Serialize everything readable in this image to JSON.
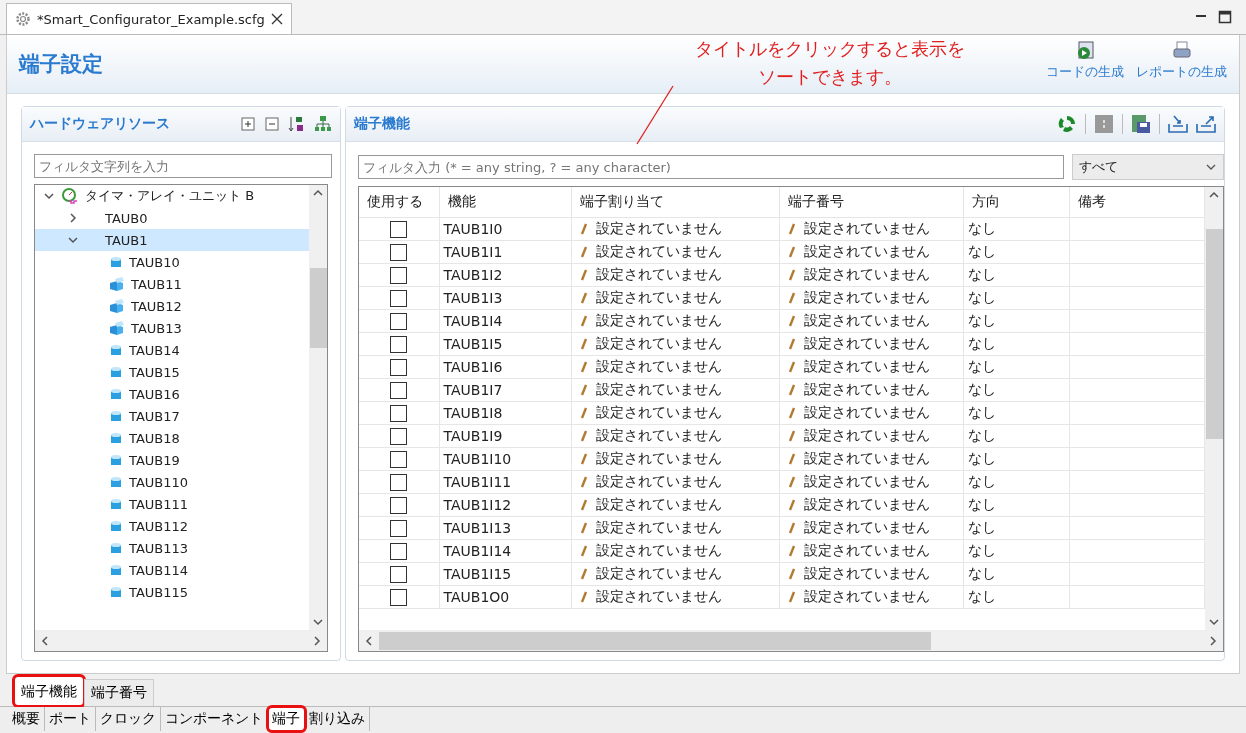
{
  "editor_tab": {
    "title": "*Smart_Configurator_Example.scfg"
  },
  "page_title": "端子設定",
  "header_actions": [
    {
      "label": "コードの生成",
      "kind": "code"
    },
    {
      "label": "レポートの生成",
      "kind": "report"
    }
  ],
  "annotation": {
    "text": "タイトルをクリックすると表示をソートできます。"
  },
  "left_panel": {
    "title": "ハードウェアリソース",
    "filter": {
      "placeholder": "フィルタ文字列を入力"
    },
    "tree": [
      {
        "label": "タイマ・アレイ・ユニット B",
        "expanded": true,
        "selected": false,
        "kind": "unit",
        "children": [
          {
            "label": "TAUB0",
            "expanded": false,
            "selected": false,
            "kind": "group"
          },
          {
            "label": "TAUB1",
            "expanded": true,
            "selected": true,
            "kind": "group",
            "children": [
              {
                "label": "TAUB10",
                "kind": "block"
              },
              {
                "label": "TAUB11",
                "kind": "open-block"
              },
              {
                "label": "TAUB12",
                "kind": "open-block"
              },
              {
                "label": "TAUB13",
                "kind": "open-block"
              },
              {
                "label": "TAUB14",
                "kind": "block"
              },
              {
                "label": "TAUB15",
                "kind": "block"
              },
              {
                "label": "TAUB16",
                "kind": "block"
              },
              {
                "label": "TAUB17",
                "kind": "block"
              },
              {
                "label": "TAUB18",
                "kind": "block"
              },
              {
                "label": "TAUB19",
                "kind": "block"
              },
              {
                "label": "TAUB110",
                "kind": "block"
              },
              {
                "label": "TAUB111",
                "kind": "block"
              },
              {
                "label": "TAUB112",
                "kind": "block"
              },
              {
                "label": "TAUB113",
                "kind": "block"
              },
              {
                "label": "TAUB114",
                "kind": "block"
              },
              {
                "label": "TAUB115",
                "kind": "block"
              }
            ]
          }
        ]
      }
    ]
  },
  "right_panel": {
    "title": "端子機能",
    "filter": {
      "placeholder": "フィルタ入力 (* = any string, ? = any character)"
    },
    "dropdown": {
      "value": "すべて"
    },
    "table": {
      "columns": [
        "使用する",
        "機能",
        "端子割り当て",
        "端子番号",
        "方向",
        "備考"
      ],
      "rows": [
        {
          "checked": false,
          "function": "TAUB1I0",
          "assignment": "設定されていません",
          "pin": "設定されていません",
          "direction": "なし"
        },
        {
          "checked": false,
          "function": "TAUB1I1",
          "assignment": "設定されていません",
          "pin": "設定されていません",
          "direction": "なし"
        },
        {
          "checked": false,
          "function": "TAUB1I2",
          "assignment": "設定されていません",
          "pin": "設定されていません",
          "direction": "なし"
        },
        {
          "checked": false,
          "function": "TAUB1I3",
          "assignment": "設定されていません",
          "pin": "設定されていません",
          "direction": "なし"
        },
        {
          "checked": false,
          "function": "TAUB1I4",
          "assignment": "設定されていません",
          "pin": "設定されていません",
          "direction": "なし"
        },
        {
          "checked": false,
          "function": "TAUB1I5",
          "assignment": "設定されていません",
          "pin": "設定されていません",
          "direction": "なし"
        },
        {
          "checked": false,
          "function": "TAUB1I6",
          "assignment": "設定されていません",
          "pin": "設定されていません",
          "direction": "なし"
        },
        {
          "checked": false,
          "function": "TAUB1I7",
          "assignment": "設定されていません",
          "pin": "設定されていません",
          "direction": "なし"
        },
        {
          "checked": false,
          "function": "TAUB1I8",
          "assignment": "設定されていません",
          "pin": "設定されていません",
          "direction": "なし"
        },
        {
          "checked": false,
          "function": "TAUB1I9",
          "assignment": "設定されていません",
          "pin": "設定されていません",
          "direction": "なし"
        },
        {
          "checked": false,
          "function": "TAUB1I10",
          "assignment": "設定されていません",
          "pin": "設定されていません",
          "direction": "なし"
        },
        {
          "checked": false,
          "function": "TAUB1I11",
          "assignment": "設定されていません",
          "pin": "設定されていません",
          "direction": "なし"
        },
        {
          "checked": false,
          "function": "TAUB1I12",
          "assignment": "設定されていません",
          "pin": "設定されていません",
          "direction": "なし"
        },
        {
          "checked": false,
          "function": "TAUB1I13",
          "assignment": "設定されていません",
          "pin": "設定されていません",
          "direction": "なし"
        },
        {
          "checked": false,
          "function": "TAUB1I14",
          "assignment": "設定されていません",
          "pin": "設定されていません",
          "direction": "なし"
        },
        {
          "checked": false,
          "function": "TAUB1I15",
          "assignment": "設定されていません",
          "pin": "設定されていません",
          "direction": "なし"
        },
        {
          "checked": false,
          "function": "TAUB1O0",
          "assignment": "設定されていません",
          "pin": "設定されていません",
          "direction": "なし"
        }
      ]
    }
  },
  "view_tabs": [
    {
      "label": "端子機能",
      "selected": true,
      "highlighted": true
    },
    {
      "label": "端子番号",
      "selected": false,
      "highlighted": false
    }
  ],
  "page_tabs": [
    {
      "label": "概要",
      "selected": false,
      "highlighted": false
    },
    {
      "label": "ポート",
      "selected": false,
      "highlighted": false
    },
    {
      "label": "クロック",
      "selected": false,
      "highlighted": false
    },
    {
      "label": "コンポーネント",
      "selected": false,
      "highlighted": false
    },
    {
      "label": "端子",
      "selected": true,
      "highlighted": true
    },
    {
      "label": "割り込み",
      "selected": false,
      "highlighted": false
    }
  ]
}
